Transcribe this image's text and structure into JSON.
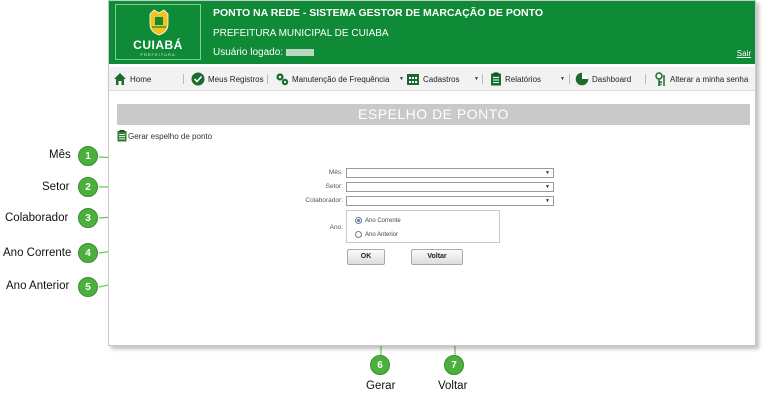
{
  "header": {
    "logo_text": "CUIABÁ",
    "logo_sub": "PREFEITURA",
    "title": "PONTO NA REDE - SISTEMA GESTOR DE MARCAÇÃO DE PONTO",
    "subtitle": "PREFEITURA MUNICIPAL DE CUIABA",
    "user_label": "Usuário logado:",
    "exit_label": "Sair",
    "color": "#0f8a37"
  },
  "nav": {
    "items": [
      {
        "label": "Home",
        "icon": "home-icon"
      },
      {
        "label": "Meus Registros",
        "icon": "checkmark-icon"
      },
      {
        "label": "Manutenção de Frequência",
        "icon": "gears-icon"
      },
      {
        "label": "Cadastros",
        "icon": "calendar-icon"
      },
      {
        "label": "Relatórios",
        "icon": "clipboard-icon"
      },
      {
        "label": "Dashboard",
        "icon": "pie-chart-icon"
      },
      {
        "label": "Alterar a minha senha",
        "icon": "key-icon"
      }
    ]
  },
  "page": {
    "title": "ESPELHO DE PONTO",
    "generate_link": "Gerar espelho de ponto"
  },
  "form": {
    "mes_label": "Mês:",
    "setor_label": "Setor:",
    "colaborador_label": "Colaborador:",
    "ano_label": "Ano:",
    "ano_corrente": "Ano Corrente",
    "ano_anterior": "Ano Anterior",
    "ok_label": "OK",
    "voltar_label": "Voltar"
  },
  "callouts": [
    {
      "num": "1",
      "label": "Mês"
    },
    {
      "num": "2",
      "label": "Setor"
    },
    {
      "num": "3",
      "label": "Colaborador"
    },
    {
      "num": "4",
      "label": "Ano Corrente"
    },
    {
      "num": "5",
      "label": "Ano Anterior"
    },
    {
      "num": "6",
      "label": "Gerar"
    },
    {
      "num": "7",
      "label": "Voltar"
    }
  ],
  "accent_color": "#4caf3e"
}
